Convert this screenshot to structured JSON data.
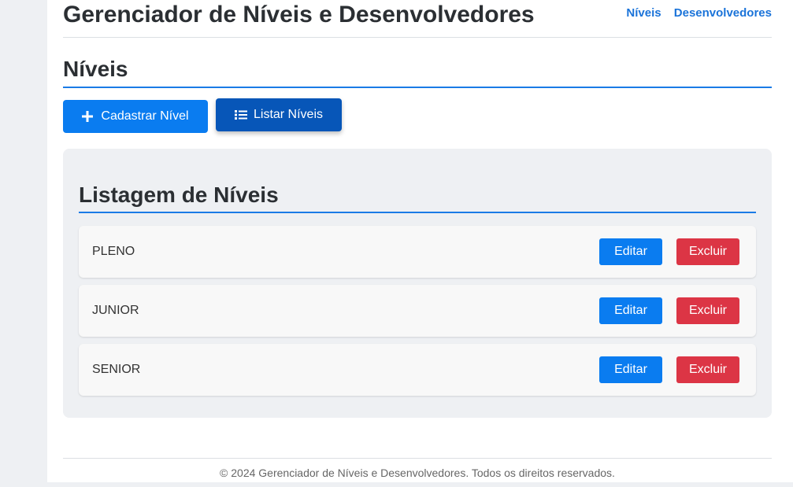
{
  "header": {
    "title": "Gerenciador de Níveis e Desenvolvedores",
    "nav": [
      "Níveis",
      "Desenvolvedores"
    ]
  },
  "section": {
    "title": "Níveis"
  },
  "actions": {
    "create_label": "Cadastrar Nível",
    "list_label": "Listar Níveis",
    "create_icon": "plus-icon",
    "list_icon": "list-icon"
  },
  "listing": {
    "title": "Listagem de Níveis",
    "items": [
      {
        "name": "PLENO",
        "edit_label": "Editar",
        "delete_label": "Excluir"
      },
      {
        "name": "JUNIOR",
        "edit_label": "Editar",
        "delete_label": "Excluir"
      },
      {
        "name": "SENIOR",
        "edit_label": "Editar",
        "delete_label": "Excluir"
      }
    ]
  },
  "footer": {
    "text": "© 2024 Gerenciador de Níveis e Desenvolvedores. Todos os direitos reservados."
  },
  "colors": {
    "primary": "#0a7cf0",
    "primary_dark": "#0756b8",
    "danger": "#dc3545",
    "link": "#1a73d9"
  }
}
